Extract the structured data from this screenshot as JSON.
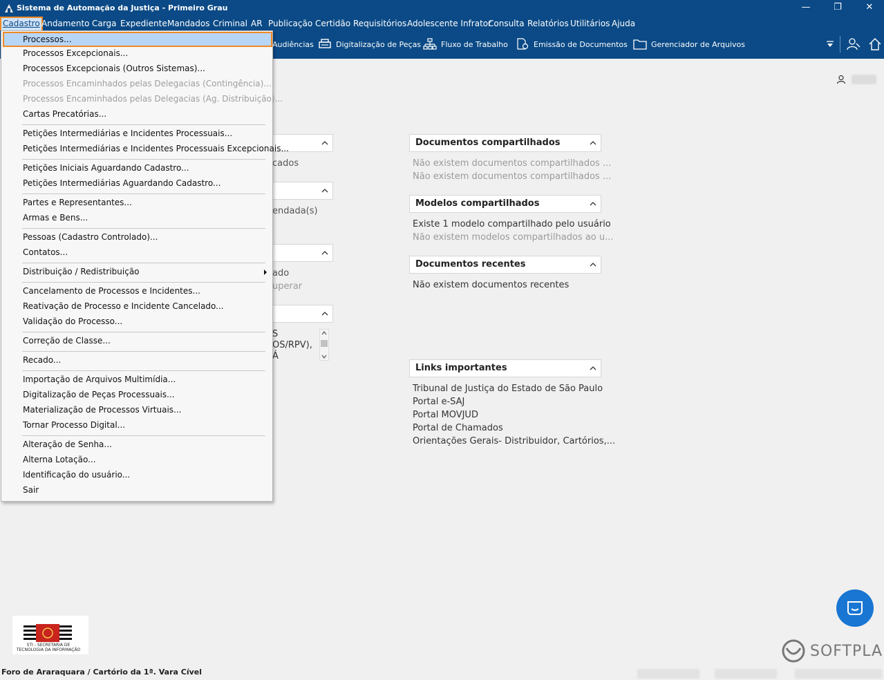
{
  "window": {
    "title": "Sistema de Automação da Justiça - Primeiro Grau",
    "minimize_glyph": "—",
    "restore_glyph": "❐",
    "close_glyph": "✕"
  },
  "menubar": {
    "items": [
      "Cadastro",
      "Andamento",
      "Carga",
      "Expediente",
      "Mandados",
      "Criminal",
      "AR",
      "Publicação",
      "Certidão",
      "Requisitórios",
      "Adolescente Infrator",
      "Consulta",
      "Relatórios",
      "Utilitários",
      "Ajuda"
    ]
  },
  "toolbar": {
    "audiencias": "Audiências",
    "digitalizacao": "Digitalização de Peças",
    "fluxo": "Fluxo de Trabalho",
    "emissao": "Emissão de Documentos",
    "gerenciador": "Gerenciador de Arquivos"
  },
  "dropdown": {
    "items": [
      "Processos...",
      "Processos Excepcionais...",
      "Processos Excepcionais (Outros Sistemas)...",
      "Processos Encaminhados pelas Delegacias (Contingência)...",
      "Processos Encaminhados pelas Delegacias (Ag. Distribuição)...",
      "Cartas Precatórias...",
      "Petições Intermediárias e Incidentes Processuais...",
      "Petições Intermediárias e Incidentes Processuais Excepcionais...",
      "Petições Iniciais Aguardando Cadastro...",
      "Petições Intermediárias Aguardando Cadastro...",
      "Partes e Representantes...",
      "Armas e Bens...",
      "Pessoas (Cadastro Controlado)...",
      "Contatos...",
      "Distribuição / Redistribuição",
      "Cancelamento de Processos e Incidentes...",
      "Reativação de Processo e Incidente Cancelado...",
      "Validação do Processo...",
      "Correção de Classe...",
      "Recado...",
      "Importação de Arquivos Multimídia...",
      "Digitalização de Peças Processuais...",
      "Materialização de Processos Virtuais...",
      "Tornar Processo Digital...",
      "Alteração de Senha...",
      "Alterna Lotação...",
      "Identificação do usuário...",
      "Sair"
    ]
  },
  "left_partials": {
    "p1_text": "cados",
    "p2_text": "endada(s)",
    "p3_line1": "ado",
    "p3_line2": "uperar",
    "p4_line1": "S",
    "p4_line2": "OS/RPV),",
    "p4_line3": "Á"
  },
  "panels": {
    "docs_compartilhados": {
      "title": "Documentos compartilhados",
      "line1": "Não existem documentos compartilhados ...",
      "line2": "Não existem documentos compartilhados ..."
    },
    "modelos": {
      "title": "Modelos compartilhados",
      "line1": "Existe 1 modelo compartilhado pelo usuário",
      "line2": "Não existem modelos compartilhados ao u..."
    },
    "recentes": {
      "title": "Documentos recentes",
      "line1": "Não existem documentos recentes"
    },
    "links": {
      "title": "Links importantes",
      "items": [
        "Tribunal de Justiça do Estado de São Paulo",
        "Portal e-SAJ",
        "Portal MOVJUD",
        "Portal de Chamados",
        "Orientações Gerais- Distribuidor, Cartórios,..."
      ]
    }
  },
  "footer": {
    "logo_caption_line1": "STI - SECRETARIA DE",
    "logo_caption_line2": "TECNOLOGIA DA INFORMAÇÃO",
    "status_text": "Foro de Araraquara / Cartório da 1ª. Vara Cível",
    "brand": "SOFTPLAN"
  },
  "colors": {
    "header_blue": "#0b4a86",
    "highlight_orange": "#f08a24",
    "selection_blue": "#b7d5f5",
    "chat_blue": "#1976d2"
  }
}
